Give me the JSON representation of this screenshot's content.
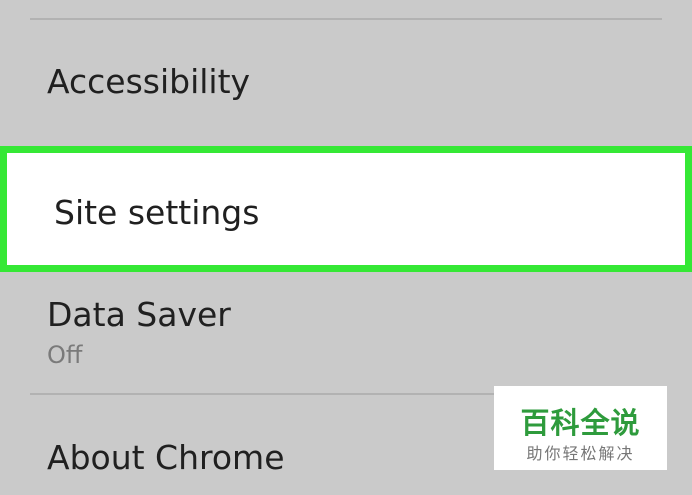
{
  "settings": {
    "items": [
      {
        "label": "Accessibility"
      },
      {
        "label": "Site settings",
        "highlighted": true
      },
      {
        "label": "Data Saver",
        "value": "Off"
      },
      {
        "label": "About Chrome"
      }
    ]
  },
  "colors": {
    "background": "#cacaca",
    "highlight_border": "#35e835",
    "highlight_fill": "#ffffff",
    "divider": "#b2b2b2"
  },
  "watermark": {
    "main": "百科全说",
    "sub": "助你轻松解决"
  }
}
